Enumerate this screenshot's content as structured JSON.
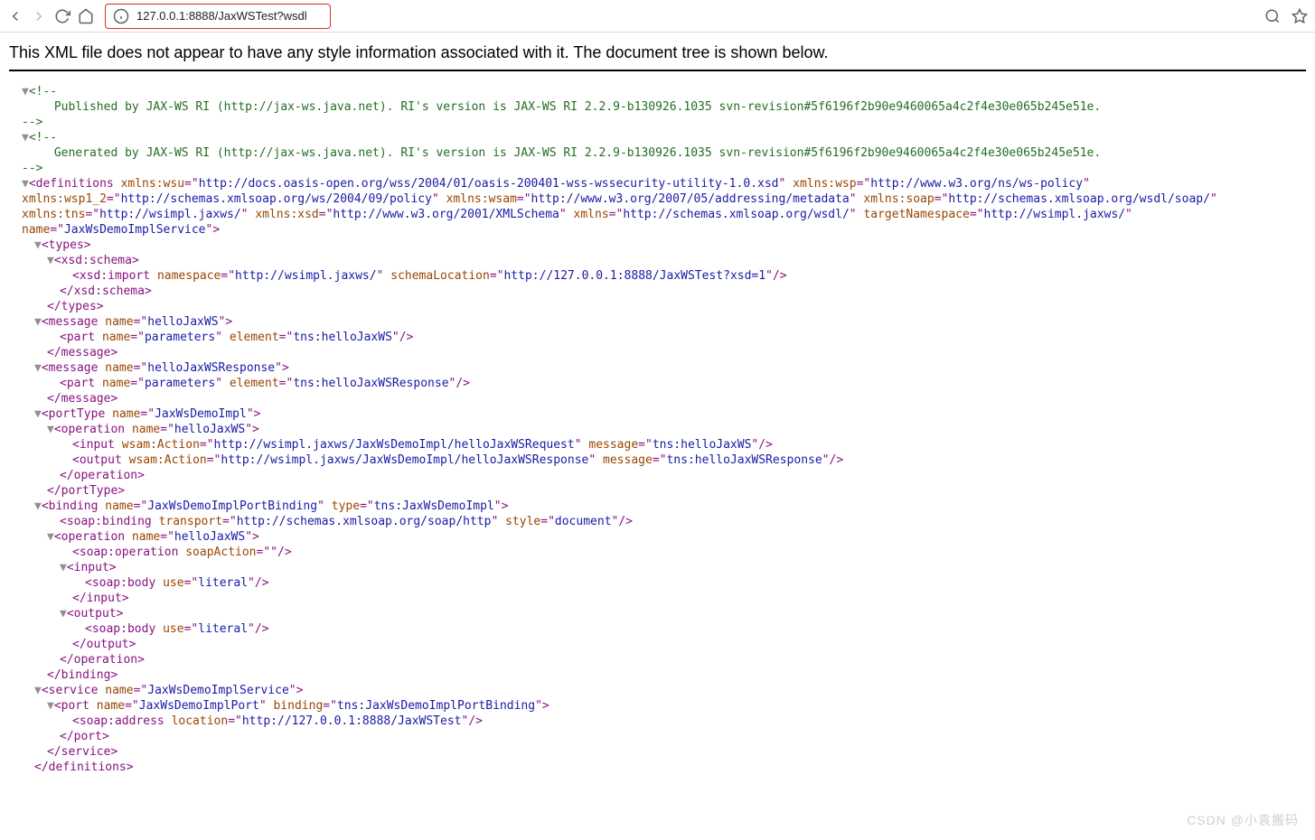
{
  "toolbar": {
    "url": "127.0.0.1:8888/JaxWSTest?wsdl"
  },
  "notice": "This XML file does not appear to have any style information associated with it. The document tree is shown below.",
  "xml": {
    "comment1_open": "<!--",
    "comment1_body": " Published by JAX-WS RI (http://jax-ws.java.net). RI's version is JAX-WS RI 2.2.9-b130926.1035 svn-revision#5f6196f2b90e9460065a4c2f4e30e065b245e51e. ",
    "comment_close": "-->",
    "comment2_open": "<!--",
    "comment2_body": " Generated by JAX-WS RI (http://jax-ws.java.net). RI's version is JAX-WS RI 2.2.9-b130926.1035 svn-revision#5f6196f2b90e9460065a4c2f4e30e065b245e51e. ",
    "defs": {
      "tag": "definitions",
      "wsu_a": "xmlns:wsu",
      "wsu_v": "http://docs.oasis-open.org/wss/2004/01/oasis-200401-wss-wssecurity-utility-1.0.xsd",
      "wsp_a": "xmlns:wsp",
      "wsp_v": "http://www.w3.org/ns/ws-policy",
      "wsp12_a": "xmlns:wsp1_2",
      "wsp12_v": "http://schemas.xmlsoap.org/ws/2004/09/policy",
      "wsam_a": "xmlns:wsam",
      "wsam_v": "http://www.w3.org/2007/05/addressing/metadata",
      "soap_a": "xmlns:soap",
      "soap_v": "http://schemas.xmlsoap.org/wsdl/soap/",
      "tns_a": "xmlns:tns",
      "tns_v": "http://wsimpl.jaxws/",
      "xsd_a": "xmlns:xsd",
      "xsd_v": "http://www.w3.org/2001/XMLSchema",
      "xmlns_a": "xmlns",
      "xmlns_v": "http://schemas.xmlsoap.org/wsdl/",
      "tn_a": "targetNamespace",
      "tn_v": "http://wsimpl.jaxws/",
      "name_a": "name",
      "name_v": "JaxWsDemoImplService"
    },
    "types_tag": "types",
    "schema_tag": "xsd:schema",
    "import": {
      "tag": "xsd:import",
      "ns_a": "namespace",
      "ns_v": "http://wsimpl.jaxws/",
      "sl_a": "schemaLocation",
      "sl_v": "http://127.0.0.1:8888/JaxWSTest?xsd=1"
    },
    "schema_close": "xsd:schema",
    "types_close": "types",
    "msg1": {
      "tag": "message",
      "name_a": "name",
      "name_v": "helloJaxWS"
    },
    "part1": {
      "tag": "part",
      "name_a": "name",
      "name_v": "parameters",
      "el_a": "element",
      "el_v": "tns:helloJaxWS"
    },
    "msg_close": "message",
    "msg2": {
      "tag": "message",
      "name_a": "name",
      "name_v": "helloJaxWSResponse"
    },
    "part2": {
      "tag": "part",
      "name_a": "name",
      "name_v": "parameters",
      "el_a": "element",
      "el_v": "tns:helloJaxWSResponse"
    },
    "pt": {
      "tag": "portType",
      "name_a": "name",
      "name_v": "JaxWsDemoImpl"
    },
    "op1": {
      "tag": "operation",
      "name_a": "name",
      "name_v": "helloJaxWS"
    },
    "input1": {
      "tag": "input",
      "wa_a": "wsam:Action",
      "wa_v": "http://wsimpl.jaxws/JaxWsDemoImpl/helloJaxWSRequest",
      "msg_a": "message",
      "msg_v": "tns:helloJaxWS"
    },
    "output1": {
      "tag": "output",
      "wa_a": "wsam:Action",
      "wa_v": "http://wsimpl.jaxws/JaxWsDemoImpl/helloJaxWSResponse",
      "msg_a": "message",
      "msg_v": "tns:helloJaxWSResponse"
    },
    "op_close": "operation",
    "pt_close": "portType",
    "bind": {
      "tag": "binding",
      "name_a": "name",
      "name_v": "JaxWsDemoImplPortBinding",
      "type_a": "type",
      "type_v": "tns:JaxWsDemoImpl"
    },
    "soapbind": {
      "tag": "soap:binding",
      "tr_a": "transport",
      "tr_v": "http://schemas.xmlsoap.org/soap/http",
      "st_a": "style",
      "st_v": "document"
    },
    "op2": {
      "tag": "operation",
      "name_a": "name",
      "name_v": "helloJaxWS"
    },
    "soapop": {
      "tag": "soap:operation",
      "sa_a": "soapAction",
      "sa_v": ""
    },
    "input_tag": "input",
    "soapbody1": {
      "tag": "soap:body",
      "use_a": "use",
      "use_v": "literal"
    },
    "input_close": "input",
    "output_tag": "output",
    "soapbody2": {
      "tag": "soap:body",
      "use_a": "use",
      "use_v": "literal"
    },
    "output_close": "output",
    "bind_close": "binding",
    "svc": {
      "tag": "service",
      "name_a": "name",
      "name_v": "JaxWsDemoImplService"
    },
    "port": {
      "tag": "port",
      "name_a": "name",
      "name_v": "JaxWsDemoImplPort",
      "bind_a": "binding",
      "bind_v": "tns:JaxWsDemoImplPortBinding"
    },
    "soapaddr": {
      "tag": "soap:address",
      "loc_a": "location",
      "loc_v": "http://127.0.0.1:8888/JaxWSTest"
    },
    "port_close": "port",
    "svc_close": "service",
    "defs_close": "definitions"
  },
  "watermark": "CSDN @小袁搬码"
}
